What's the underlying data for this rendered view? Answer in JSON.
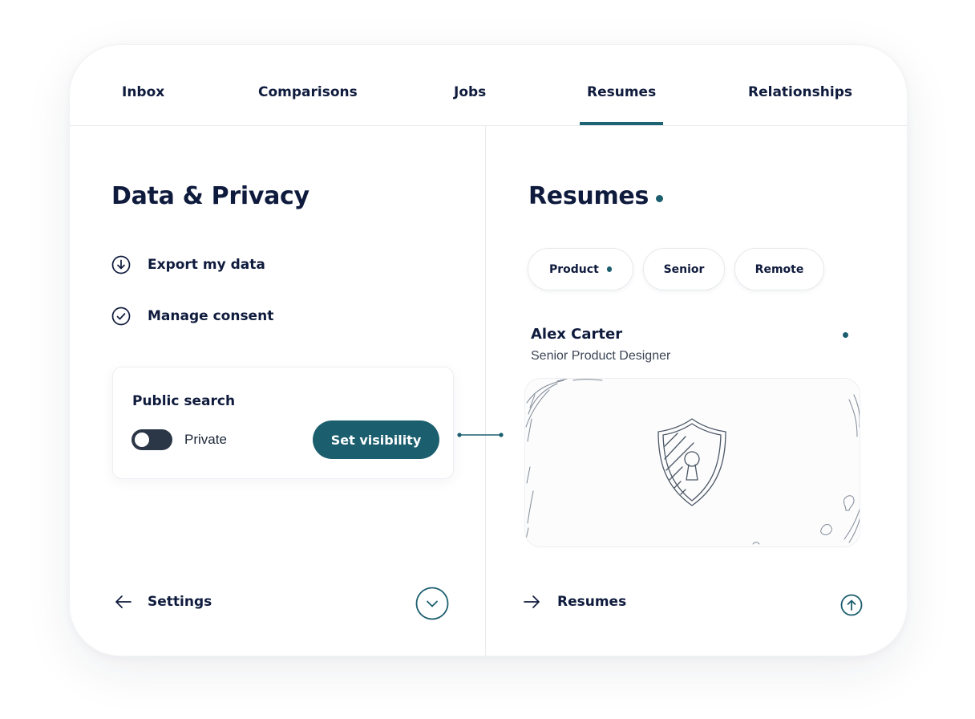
{
  "tabs": [
    {
      "label": "Inbox",
      "active": false
    },
    {
      "label": "Comparisons",
      "active": false
    },
    {
      "label": "Jobs",
      "active": false
    },
    {
      "label": "Resumes",
      "active": true
    },
    {
      "label": "Relationships",
      "active": false
    }
  ],
  "left": {
    "title": "Data & Privacy",
    "actions": [
      {
        "label": "Export my data",
        "icon": "download-circle-icon"
      },
      {
        "label": "Manage consent",
        "icon": "check-circle-icon"
      }
    ],
    "panel": {
      "title": "Public search",
      "toggle_state_label": "Private",
      "toggle_on": false,
      "button_label": "Set visibility"
    },
    "footer": {
      "label": "Settings",
      "icon": "arrow-left-icon",
      "circle_icon": "chevron-down-icon"
    }
  },
  "right": {
    "title": "Resumes",
    "chips": [
      {
        "label": "Product",
        "has_dot": true
      },
      {
        "label": "Senior",
        "has_dot": false
      },
      {
        "label": "Remote",
        "has_dot": false
      }
    ],
    "person": {
      "name": "Alex Carter",
      "role": "Senior Product Designer"
    },
    "illustration_icon": "shield-keyhole-icon",
    "footer": {
      "label": "Resumes",
      "icon": "arrow-right-icon",
      "circle_icon": "arrow-up-circle-icon"
    }
  },
  "colors": {
    "accent": "#1b5e6e",
    "text": "#0f1b3d",
    "toggle_track": "#2b3646",
    "border": "#e9ecef"
  }
}
